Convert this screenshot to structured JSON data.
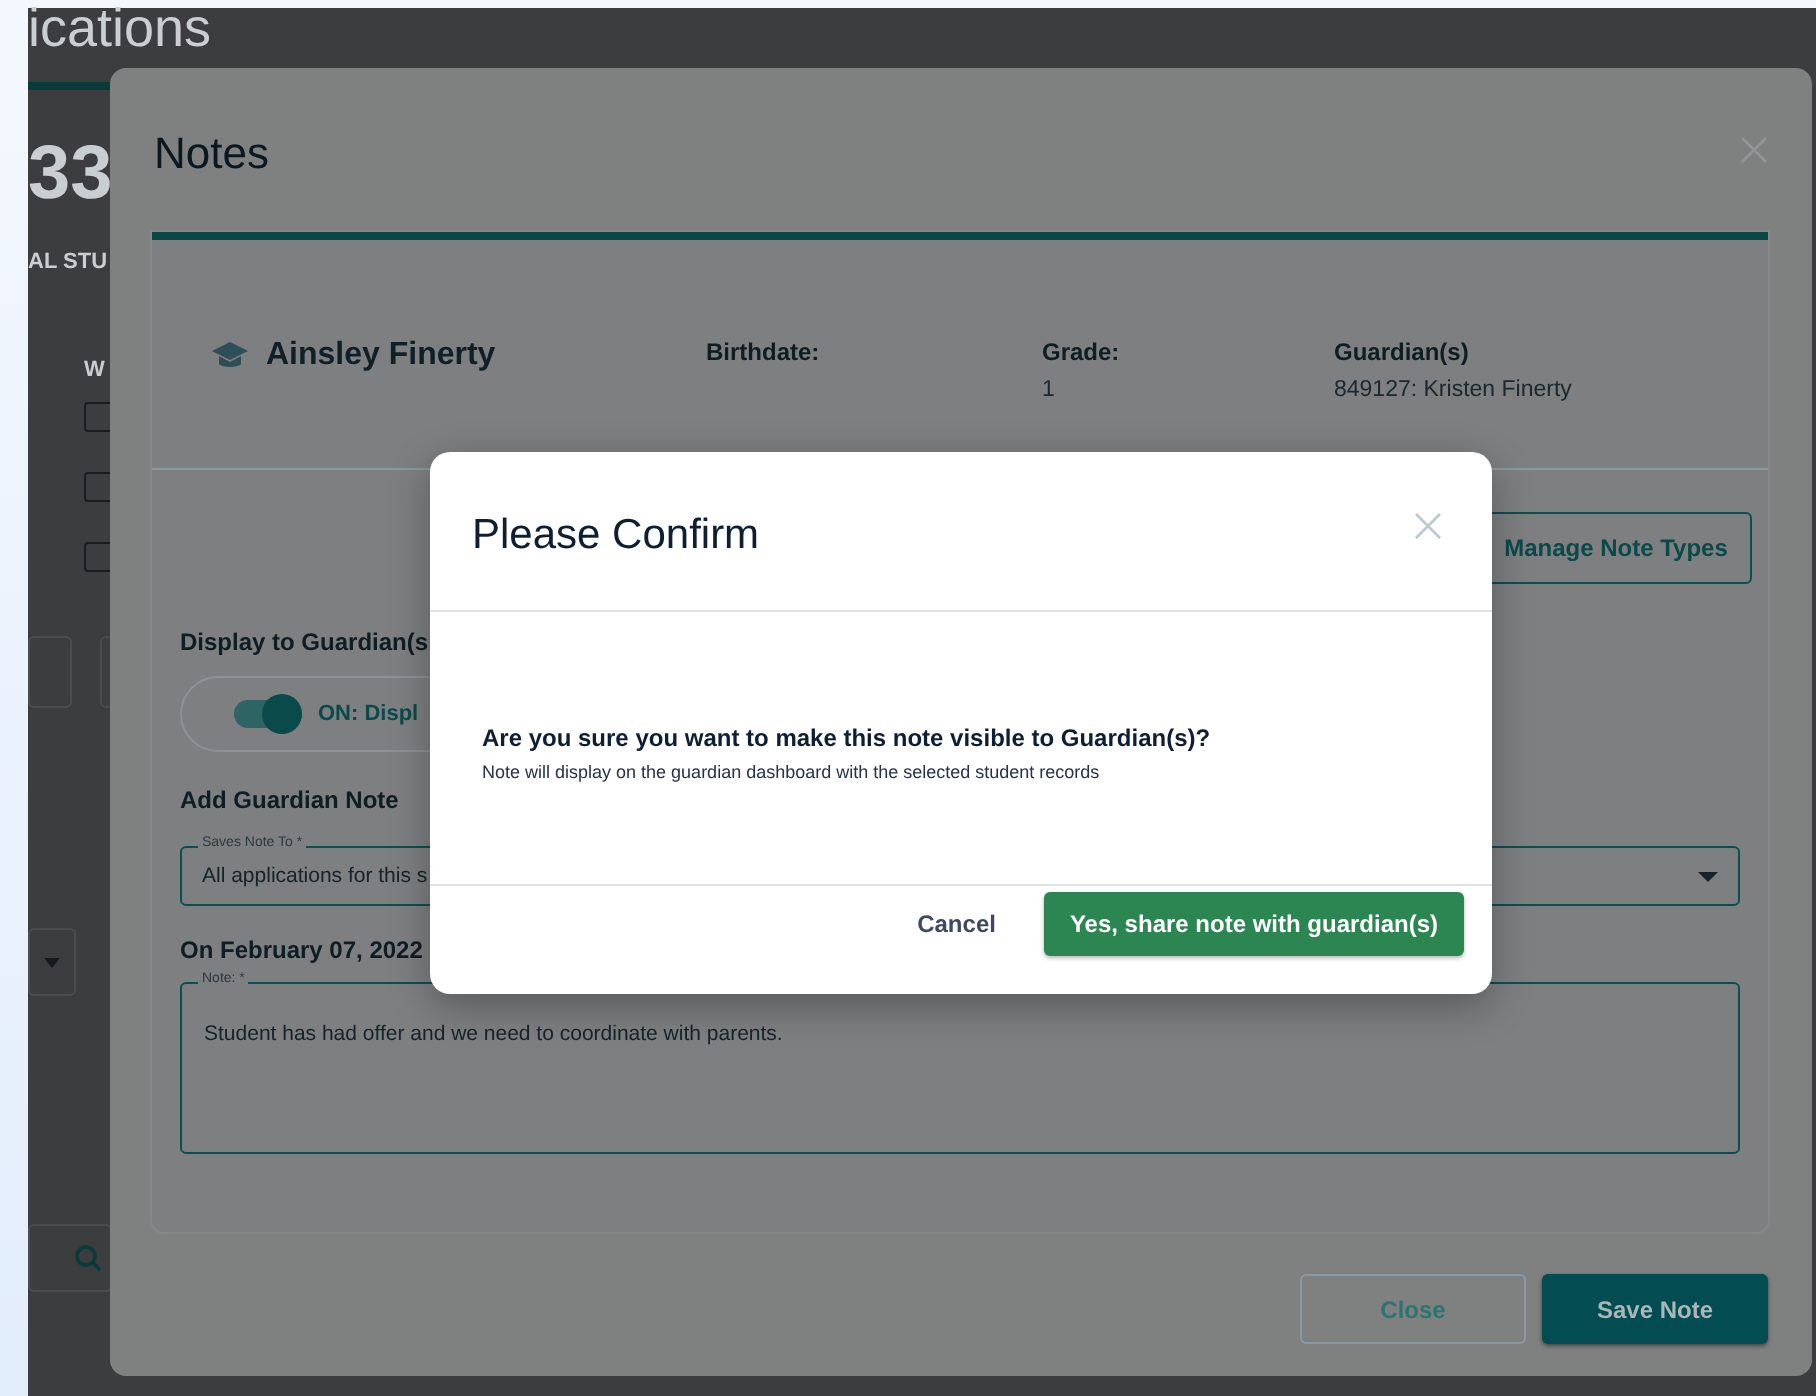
{
  "background_page": {
    "title": "ications",
    "stat_value": "33",
    "stat_label": "AL STU",
    "filter_label": "W",
    "checkboxes": [
      {
        "checked": false
      },
      {
        "checked": false
      },
      {
        "checked": false
      }
    ]
  },
  "notes_dialog": {
    "title": "Notes",
    "student": {
      "name": "Ainsley Finerty",
      "fields": [
        {
          "label": "Birthdate:"
        },
        {
          "label": "Grade:",
          "value": "1"
        },
        {
          "label": "Guardian(s)",
          "value": "849127: Kristen Finerty"
        }
      ]
    },
    "manage_button": "Manage Note Types",
    "display_label": "Display to Guardian(s",
    "toggle": {
      "on": true,
      "label": "ON: Displ"
    },
    "add_note_heading": "Add Guardian Note",
    "saves_to": {
      "label": "Saves Note To *",
      "value": "All applications for this s"
    },
    "note_date": "On February 07, 2022",
    "note": {
      "label": "Note: *",
      "value": "Student has had offer and we need to coordinate with parents."
    },
    "buttons": [
      {
        "label": "Close",
        "kind": "secondary"
      },
      {
        "label": "Save Note",
        "kind": "primary"
      }
    ]
  },
  "confirm_dialog": {
    "title": "Please Confirm",
    "question": "Are you sure you want to make this note visible to Guardian(s)?",
    "detail": "Note will display on the guardian dashboard with the selected student records",
    "buttons": [
      {
        "label": "Cancel",
        "kind": "text"
      },
      {
        "label": "Yes, share note with guardian(s)",
        "kind": "primary"
      }
    ]
  }
}
